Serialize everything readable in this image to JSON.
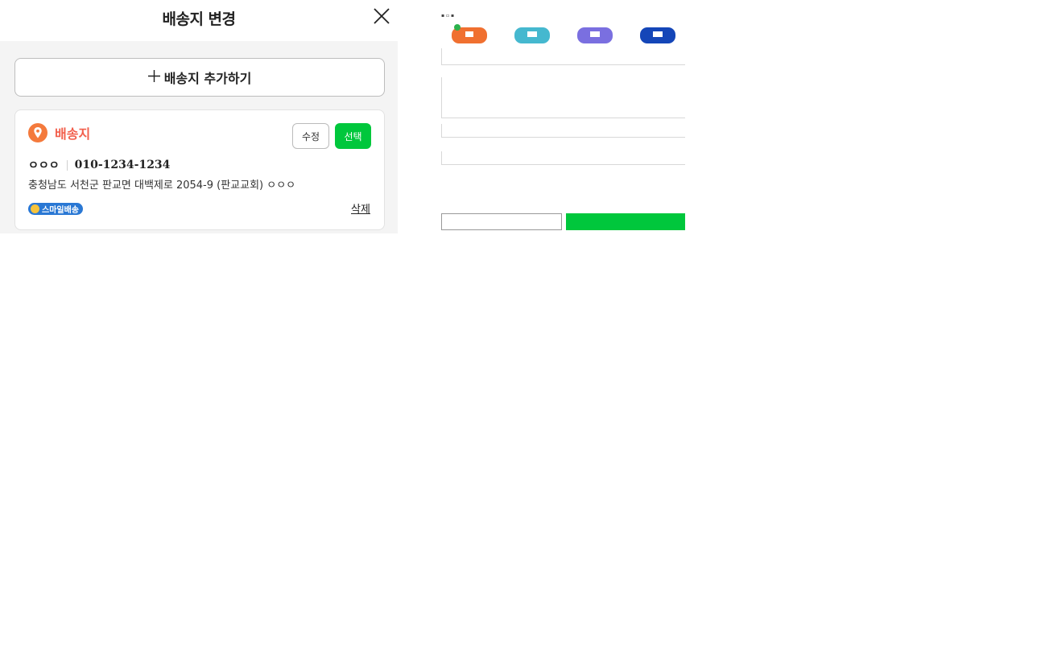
{
  "modal": {
    "title": "배송지 변경",
    "add_button_label": "배송지 추가하기"
  },
  "card": {
    "label": "배송지",
    "edit_label": "수정",
    "select_label": "선택",
    "name": "ㅇㅇㅇ",
    "phone": "010-1234-1234",
    "address": "충청남도 서천군 판교면 대백제로 2054-9 (판교교회) ㅇㅇㅇ",
    "badge_label": "스마일배송",
    "delete_label": "삭제"
  },
  "colors": {
    "accent_green": "#00c73c",
    "label_red": "#f25f4c",
    "pin_orange": "#f47a3c",
    "badge_blue": "#2a78d4"
  },
  "preview": {
    "bag_icons": [
      "bag-orange-icon",
      "bag-teal-icon",
      "bag-purple-icon",
      "bag-navy-icon"
    ]
  }
}
